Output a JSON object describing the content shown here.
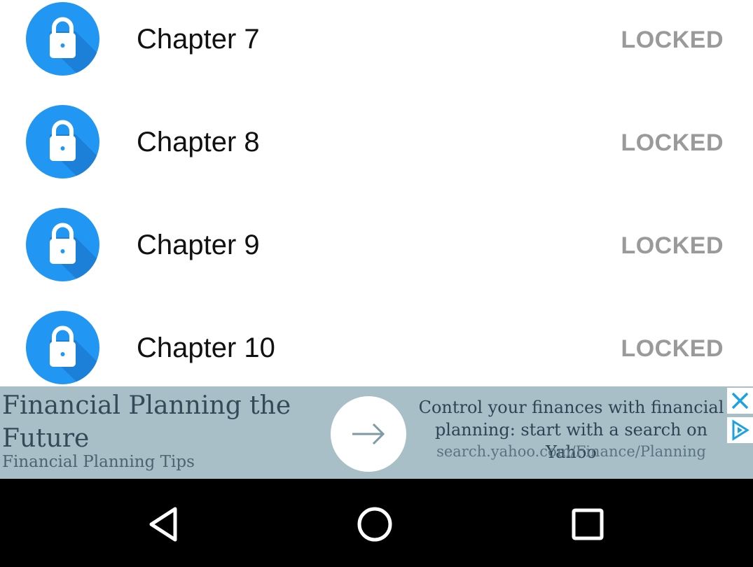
{
  "chapters": [
    {
      "title": "Chapter 7",
      "status": "LOCKED"
    },
    {
      "title": "Chapter 8",
      "status": "LOCKED"
    },
    {
      "title": "Chapter 9",
      "status": "LOCKED"
    },
    {
      "title": "Chapter 10",
      "status": "LOCKED"
    }
  ],
  "icons": {
    "chapter": "lock-icon",
    "ad_action": "arrow-right-icon",
    "ad_close": "close-icon",
    "ad_choices": "ad-choices-icon",
    "nav_back": "back-icon",
    "nav_home": "home-icon",
    "nav_recents": "recents-icon"
  },
  "ad": {
    "headline": "Financial Planning the Future",
    "subline": "Financial Planning Tips",
    "body": "Control your finances with financial planning: start with a search on Yahoo",
    "url": "search.yahoo.com/Finance/Planning"
  },
  "colors": {
    "accent": "#2196f3",
    "status": "#9a9a9a",
    "ad_background": "#a9bfc8",
    "ad_icon": "#1da1e2"
  }
}
